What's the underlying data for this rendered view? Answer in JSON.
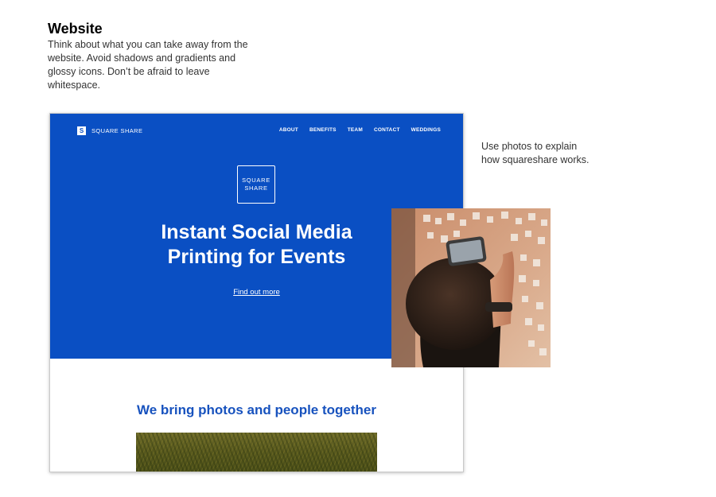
{
  "intro": {
    "title": "Website",
    "text": "Think about what you can take away from the website. Avoid shadows and gradients and glossy icons. Don’t be afraid to leave whitespace."
  },
  "side_note": "Use photos to explain how squareshare works.",
  "mockup": {
    "logo_mark": "S",
    "logo_text": "SQUARE SHARE",
    "nav": [
      "ABOUT",
      "BENEFITS",
      "TEAM",
      "CONTACT",
      "WEDDINGS"
    ],
    "badge": [
      "SQUARE",
      "SHARE"
    ],
    "headline_line1": "Instant Social Media",
    "headline_line2": "Printing for Events",
    "cta": "Find out more",
    "section_title": "We bring photos and people together"
  },
  "colors": {
    "brand_blue": "#0a4fc3",
    "title_blue": "#1752be"
  }
}
